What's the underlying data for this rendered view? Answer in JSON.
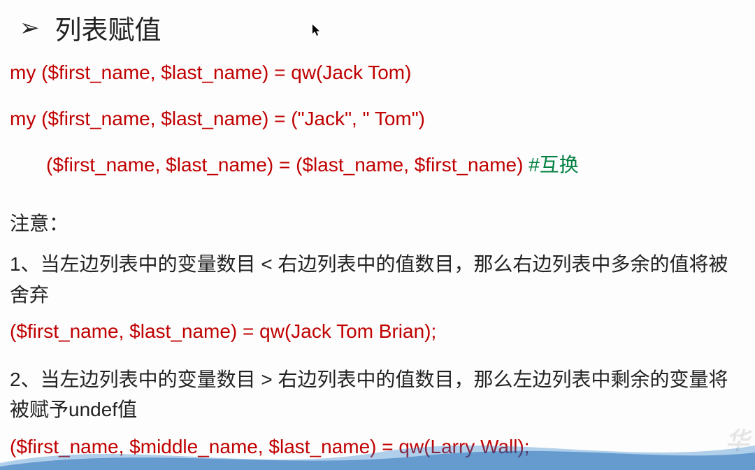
{
  "heading": "列表赋值",
  "code": {
    "line1": "my ($first_name, $last_name) = qw(Jack Tom)",
    "line2": "my ($first_name, $last_name) = (\"Jack\", \" Tom\")",
    "line3_code": "($first_name, $last_name) = ($last_name, $first_name)  ",
    "line3_comment": "#互换"
  },
  "notes": {
    "label": "注意：",
    "item1": "1、当左边列表中的变量数目 < 右边列表中的值数目，那么右边列表中多余的值将被舍弃",
    "code1": "($first_name, $last_name) = qw(Jack Tom Brian);",
    "item2": "2、当左边列表中的变量数目 > 右边列表中的值数目，那么左边列表中剩余的变量将被赋予undef值",
    "code2": "($first_name, $middle_name, $last_name) = qw(Larry Wall);"
  },
  "cursor_glyph": "▸",
  "watermark": "华"
}
